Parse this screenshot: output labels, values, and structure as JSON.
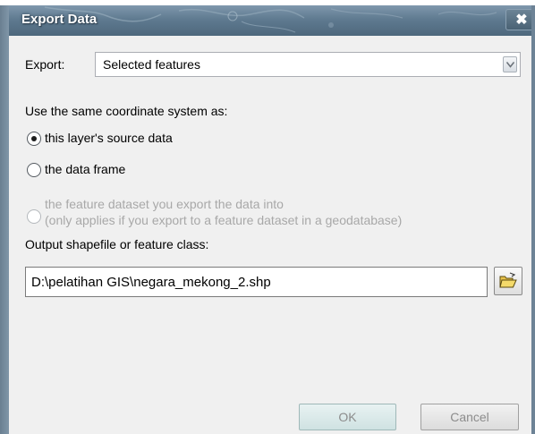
{
  "window": {
    "title": "Export Data",
    "close_glyph": "✖"
  },
  "export": {
    "label": "Export:",
    "selected": "Selected features",
    "arrow_icon": "chevron-down-icon"
  },
  "coordinate_system": {
    "label": "Use the same coordinate system as:",
    "options": [
      {
        "label": "this layer's source data",
        "checked": true,
        "enabled": true
      },
      {
        "label": "the data frame",
        "checked": false,
        "enabled": true
      },
      {
        "label": "the feature dataset you export the data into",
        "note": "(only applies if you export to a feature dataset in a geodatabase)",
        "checked": false,
        "enabled": false
      }
    ]
  },
  "output": {
    "label": "Output shapefile or feature class:",
    "value": "D:\\pelatihan GIS\\negara_mekong_2.shp",
    "browse_icon": "open-folder-icon"
  },
  "buttons": {
    "ok": "OK",
    "cancel": "Cancel"
  },
  "colors": {
    "title_bar": "#5f7a90",
    "dialog_background": "#f0f0f0",
    "disabled_text": "#a8a8a8"
  }
}
